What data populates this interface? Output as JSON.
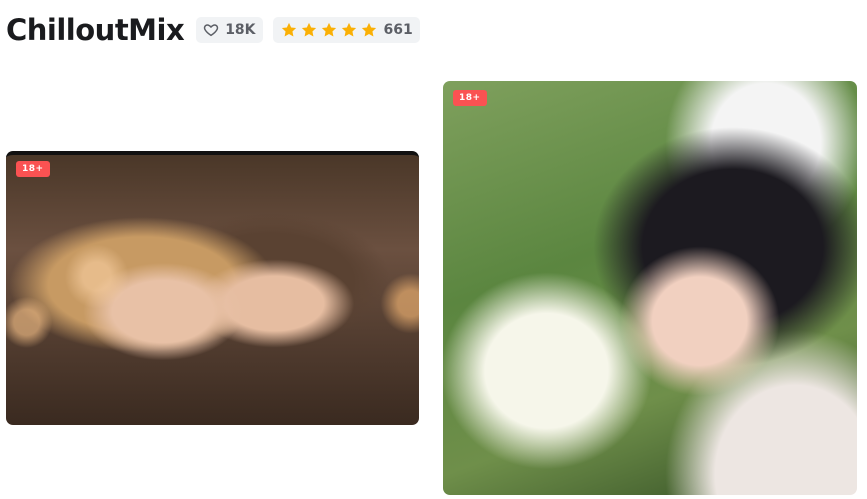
{
  "model": {
    "title": "ChilloutMix"
  },
  "stats": {
    "favorites": "18K",
    "rating_count": "661",
    "rating_stars": 5,
    "star_color": "#fab005",
    "heart_icon": "heart-outline-icon"
  },
  "gallery": {
    "items": [
      {
        "badge": "18+"
      },
      {
        "badge": "18+"
      }
    ],
    "badge_color": "#fa5252"
  }
}
